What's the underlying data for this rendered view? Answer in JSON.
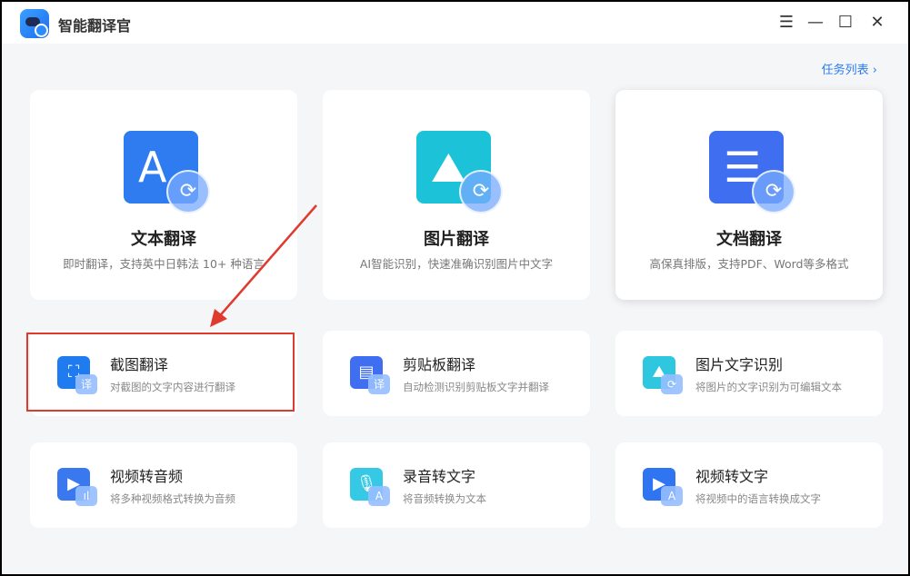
{
  "app": {
    "title": "智能翻译官"
  },
  "window_controls": {
    "menu": "☰",
    "minimize": "—",
    "maximize": "☐",
    "close": "✕"
  },
  "task_list": "任务列表 ›",
  "big_cards": [
    {
      "title": "文本翻译",
      "desc": "即时翻译，支持英中日韩法 10+ 种语言",
      "glyph": "A",
      "color": "#2f7cf0"
    },
    {
      "title": "图片翻译",
      "desc": "AI智能识别，快速准确识别图片中文字",
      "glyph": "⛰",
      "color": "#1cc3d8"
    },
    {
      "title": "文档翻译",
      "desc": "高保真排版，支持PDF、Word等多格式",
      "glyph": "☰",
      "color": "#3f6ff0"
    }
  ],
  "small_cards": [
    {
      "title": "截图翻译",
      "desc": "对截图的文字内容进行翻译",
      "glyph": "⛶",
      "badge": "译",
      "color": "#1f7cf0"
    },
    {
      "title": "剪贴板翻译",
      "desc": "自动检测识别剪贴板文字并翻译",
      "glyph": "▤",
      "badge": "译",
      "color": "#3f6ff0"
    },
    {
      "title": "图片文字识别",
      "desc": "将图片的文字识别为可编辑文本",
      "glyph": "⛰",
      "badge": "⟳",
      "color": "#2fc6e0"
    },
    {
      "title": "视频转音频",
      "desc": "将多种视频格式转换为音频",
      "glyph": "▶",
      "badge": "ıl",
      "color": "#3a78f0"
    },
    {
      "title": "录音转文字",
      "desc": "将音频转换为文本",
      "glyph": "🎙",
      "badge": "A",
      "color": "#36c9e6"
    },
    {
      "title": "视频转文字",
      "desc": "将视频中的语言转换成文字",
      "glyph": "▶",
      "badge": "A",
      "color": "#2f74f0"
    }
  ]
}
